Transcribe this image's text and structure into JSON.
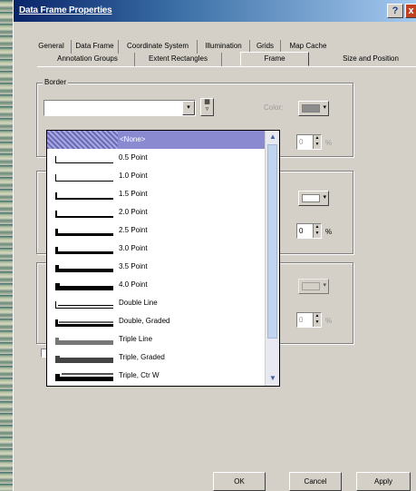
{
  "window": {
    "title": "Data Frame Properties"
  },
  "titlebar": {
    "help_label": "?",
    "close_label": "x"
  },
  "tabs_row1": [
    "General",
    "Data Frame",
    "Coordinate System",
    "Illumination",
    "Grids",
    "Map Cache"
  ],
  "tabs_row2": [
    "Annotation Groups",
    "Extent Rectangles",
    "Frame",
    "Size and Position"
  ],
  "active_tab": "Frame",
  "border": {
    "group_title": "Border",
    "color_label": "Color:",
    "gap_value": "0",
    "pct": "%"
  },
  "background": {
    "gap_value": "0",
    "pct": "%",
    "color": "#ffffff"
  },
  "shadow": {
    "gap_value": "0",
    "pct": "%"
  },
  "dropdown": {
    "items": [
      "<None>",
      "0.5 Point",
      "1.0 Point",
      "1.5 Point",
      "2.0 Point",
      "2.5 Point",
      "3.0 Point",
      "3.5 Point",
      "4.0 Point",
      "Double Line",
      "Double, Graded",
      "Triple Line",
      "Triple, Graded",
      "Triple, Ctr W"
    ],
    "selected_index": 0
  },
  "buttons": {
    "ok": "OK",
    "cancel": "Cancel",
    "apply": "Apply"
  },
  "icons": {
    "scroll_up": "▲",
    "scroll_down": "▼",
    "drop": "▾",
    "spin_up": "▲",
    "spin_down": "▼"
  },
  "colors": {
    "title_start": "#0a246a",
    "title_end": "#a6caf0",
    "selection": "#8a8ad0"
  }
}
